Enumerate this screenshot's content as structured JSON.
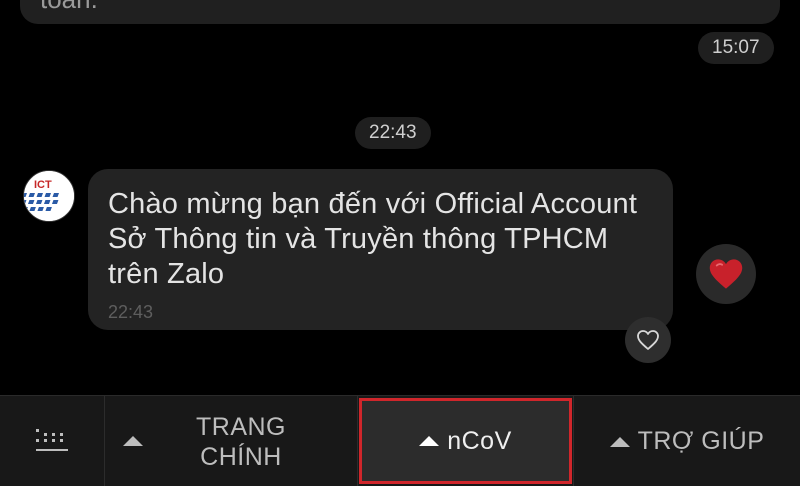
{
  "previous_message": {
    "text": "toàn.",
    "time": "15:07"
  },
  "time_divider": "22:43",
  "message": {
    "lines": [
      "Chào mừng bạn đến với Official Account",
      "Sở Thông tin và Truyền thông TPHCM",
      "trên Zalo"
    ],
    "time": "22:43"
  },
  "avatar": {
    "label": "ICT"
  },
  "menu": {
    "home": {
      "line1": "TRANG",
      "line2": "CHÍNH"
    },
    "ncov": "nCoV",
    "help": "TRỢ GIÚP"
  },
  "colors": {
    "background": "#000000",
    "bubble": "#232323",
    "bar": "#181818",
    "highlight_border": "#d0262b",
    "heart": "#c8212b"
  },
  "icons": {
    "keyboard": "keyboard-icon",
    "reaction": "heart-outline-icon",
    "heart": "heart-filled-icon",
    "caret": "caret-up-icon"
  }
}
